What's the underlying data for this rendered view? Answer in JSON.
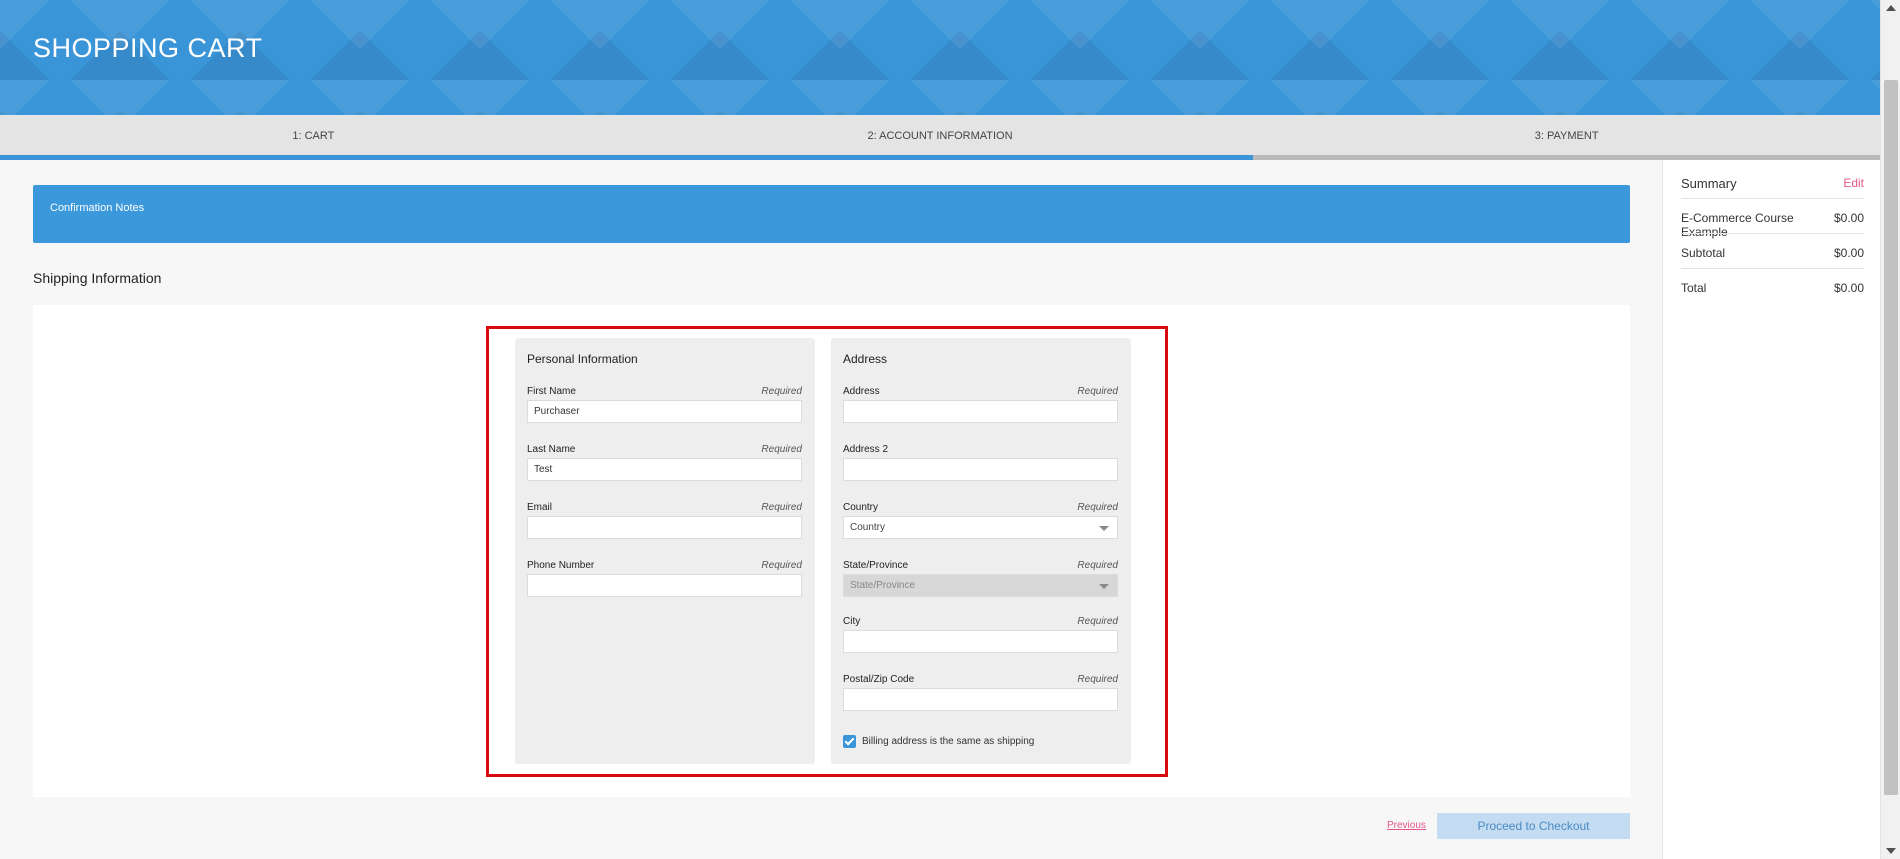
{
  "header": {
    "title": "SHOPPING CART"
  },
  "steps": [
    {
      "label": "1: CART"
    },
    {
      "label": "2: ACCOUNT INFORMATION"
    },
    {
      "label": "3: PAYMENT"
    }
  ],
  "main": {
    "notes_label": "Confirmation Notes",
    "shipping_title": "Shipping Information",
    "personal": {
      "title": "Personal Information",
      "required_text": "Required",
      "first_name": {
        "label": "First Name",
        "value": "Purchaser"
      },
      "last_name": {
        "label": "Last Name",
        "value": "Test"
      },
      "email": {
        "label": "Email",
        "value": ""
      },
      "phone": {
        "label": "Phone Number",
        "value": ""
      }
    },
    "address": {
      "title": "Address",
      "required_text": "Required",
      "address1": {
        "label": "Address",
        "value": ""
      },
      "address2": {
        "label": "Address 2",
        "value": ""
      },
      "country": {
        "label": "Country",
        "selected": "Country"
      },
      "state": {
        "label": "State/Province",
        "selected": "State/Province"
      },
      "city": {
        "label": "City",
        "value": ""
      },
      "postal": {
        "label": "Postal/Zip Code",
        "value": ""
      },
      "billing_same": {
        "label": "Billing address is the same as shipping",
        "checked": true
      }
    },
    "actions": {
      "previous": "Previous",
      "proceed": "Proceed to Checkout"
    }
  },
  "summary": {
    "title": "Summary",
    "edit": "Edit",
    "item": {
      "name": "E-Commerce Course Example",
      "price": "$0.00"
    },
    "subtotal": {
      "label": "Subtotal",
      "value": "$0.00"
    },
    "total": {
      "label": "Total",
      "value": "$0.00"
    }
  },
  "colors": {
    "accent": "#3a95d8",
    "link": "#e4578c",
    "highlight": "#d9090f"
  }
}
